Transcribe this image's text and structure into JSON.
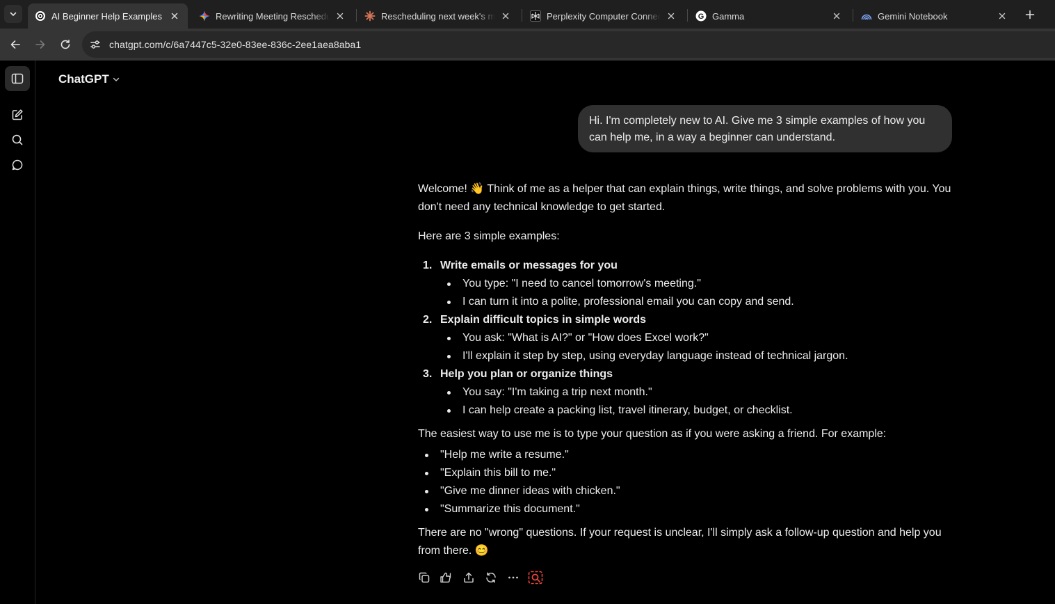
{
  "browser": {
    "tabs": [
      {
        "title": "AI Beginner Help Examples",
        "icon": "chatgpt-icon",
        "active": true
      },
      {
        "title": "Rewriting Meeting Reschedule",
        "icon": "gemini-icon",
        "active": false
      },
      {
        "title": "Rescheduling next week's mee",
        "icon": "claude-icon",
        "active": false
      },
      {
        "title": "Perplexity Computer Connecto",
        "icon": "perplexity-icon",
        "active": false
      },
      {
        "title": "Gamma",
        "icon": "google-icon",
        "active": false
      },
      {
        "title": "Gemini Notebook",
        "icon": "notebook-icon",
        "active": false
      }
    ],
    "url": "chatgpt.com/c/6a7447c5-32e0-83ee-836c-2ee1aea8aba1"
  },
  "app": {
    "model_label": "ChatGPT",
    "user_message": "Hi. I'm completely new to AI. Give me 3 simple examples of how you can help me, in a way a beginner can understand.",
    "answer": {
      "intro": "Welcome! 👋 Think of me as a helper that can explain things, write things, and solve problems with you. You don't need any technical knowledge to get started.",
      "lead": "Here are 3 simple examples:",
      "examples": [
        {
          "num": "1.",
          "title": "Write emails or messages for you",
          "bullets": [
            "You type: \"I need to cancel tomorrow's meeting.\"",
            "I can turn it into a polite, professional email you can copy and send."
          ]
        },
        {
          "num": "2.",
          "title": "Explain difficult topics in simple words",
          "bullets": [
            "You ask: \"What is AI?\" or \"How does Excel work?\"",
            "I'll explain it step by step, using everyday language instead of technical jargon."
          ]
        },
        {
          "num": "3.",
          "title": "Help you plan or organize things",
          "bullets": [
            "You say: \"I'm taking a trip next month.\"",
            "I can help create a packing list, travel itinerary, budget, or checklist."
          ]
        }
      ],
      "easiest": "The easiest way to use me is to type your question as if you were asking a friend. For example:",
      "prompts": [
        "\"Help me write a resume.\"",
        "\"Explain this bill to me.\"",
        "\"Give me dinner ideas with chicken.\"",
        "\"Summarize this document.\""
      ],
      "closing": "There are no \"wrong\" questions. If your request is unclear, I'll simply ask a follow-up question and help you from there. 😊"
    }
  },
  "colors": {
    "accent_red": "#e8453c",
    "bubble": "#303030"
  }
}
